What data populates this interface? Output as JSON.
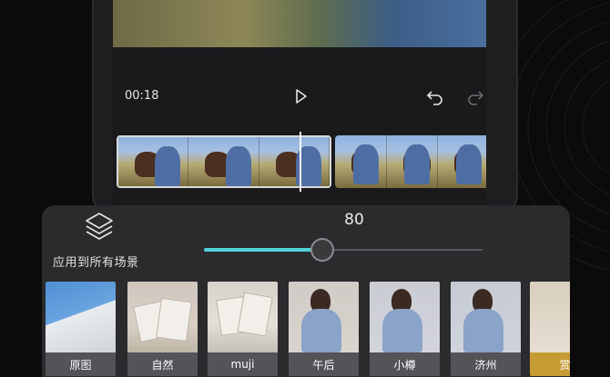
{
  "player": {
    "current_time": "00:18"
  },
  "panel": {
    "apply_all_label": "应用到所有场景",
    "intensity": 80
  },
  "filters": [
    {
      "label": "原图",
      "style": "sky"
    },
    {
      "label": "自然",
      "style": "cards"
    },
    {
      "label": "muji",
      "style": "cards2"
    },
    {
      "label": "午后",
      "style": "woman-warm"
    },
    {
      "label": "小樽",
      "style": "woman"
    },
    {
      "label": "济州",
      "style": "woman-cool"
    },
    {
      "label": "赏",
      "style": "misc"
    }
  ],
  "icons": {
    "play": "play-icon",
    "undo": "undo-icon",
    "redo": "redo-icon",
    "layers": "layers-icon"
  },
  "colors": {
    "accent": "#4fd1d9",
    "panel_bg": "#2b2b2e",
    "selected_caption": "#c79b34"
  }
}
